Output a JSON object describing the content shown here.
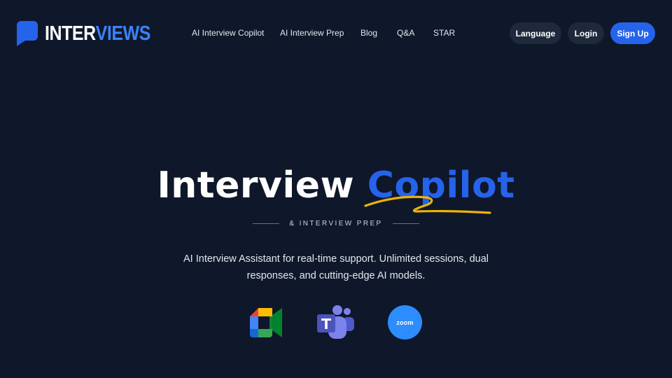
{
  "brand": {
    "name_part1": "INTER",
    "name_part2": "VIEWS",
    "accent_color": "#2563eb"
  },
  "nav": {
    "links": [
      {
        "label": "AI Interview Copilot"
      },
      {
        "label": "AI Interview Prep"
      },
      {
        "label": "Blog"
      },
      {
        "label": "Q&A"
      },
      {
        "label": "STAR"
      }
    ],
    "language_label": "Language",
    "login_label": "Login",
    "signup_label": "Sign Up"
  },
  "hero": {
    "title_part1": "Interview",
    "title_part2": "Copilot",
    "subtitle": "& INTERVIEW PREP",
    "tagline": "AI Interview Assistant for real-time support. Unlimited sessions, dual responses, and cutting-edge AI models."
  },
  "integrations": [
    {
      "name": "Google Meet",
      "icon": "google-meet-icon"
    },
    {
      "name": "Microsoft Teams",
      "icon": "microsoft-teams-icon"
    },
    {
      "name": "Zoom",
      "icon": "zoom-icon",
      "label": "zoom"
    }
  ],
  "colors": {
    "background": "#0f172a",
    "button_dark": "#1e293b",
    "scribble": "#eab308",
    "zoom_blue": "#2d8cff"
  }
}
